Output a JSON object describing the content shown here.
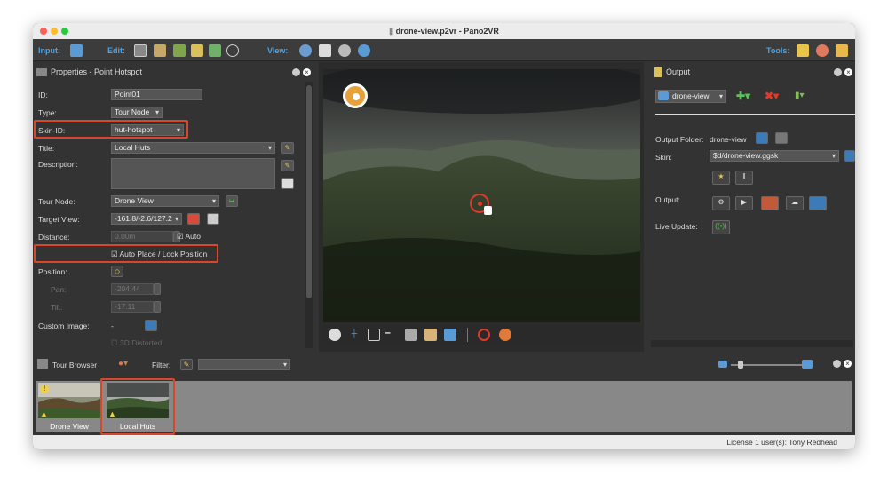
{
  "window": {
    "title": "drone-view.p2vr - Pano2VR"
  },
  "toolbar": {
    "input_label": "Input:",
    "edit_label": "Edit:",
    "view_label": "View:",
    "tools_label": "Tools:"
  },
  "properties": {
    "title": "Properties - Point Hotspot",
    "id_label": "ID:",
    "id_value": "Point01",
    "type_label": "Type:",
    "type_value": "Tour Node",
    "skin_id_label": "Skin-ID:",
    "skin_id_value": "hut-hotspot",
    "title_label": "Title:",
    "title_value": "Local Huts",
    "description_label": "Description:",
    "tour_node_label": "Tour Node:",
    "tour_node_value": "Drone View",
    "target_view_label": "Target View:",
    "target_view_value": "-161.8/-2.6/127.2",
    "distance_label": "Distance:",
    "distance_value": "0.00m",
    "auto_label": "Auto",
    "auto_place_label": "Auto Place / Lock Position",
    "position_label": "Position:",
    "pan_label": "Pan:",
    "pan_value": "-204.44",
    "tilt_label": "Tilt:",
    "tilt_value": "-17.11",
    "custom_image_label": "Custom Image:",
    "custom_image_value": "-",
    "distorted_label": "3D Distorted"
  },
  "output": {
    "title": "Output",
    "project_value": "drone-view",
    "folder_label": "Output Folder:",
    "folder_value": "drone-view",
    "skin_label": "Skin:",
    "skin_value": "$d/drone-view.ggsk",
    "output_label": "Output:",
    "live_update_label": "Live Update:"
  },
  "tour_browser": {
    "title": "Tour Browser",
    "filter_label": "Filter:",
    "nodes": [
      {
        "label": "Drone View"
      },
      {
        "label": "Local Huts"
      }
    ]
  },
  "status": {
    "license_text": "License 1 user(s): Tony Redhead"
  },
  "colors": {
    "accent": "#4aa3e8",
    "highlight": "#d9472b",
    "hotspot": "#e8a13a",
    "target": "#e03a2a"
  }
}
